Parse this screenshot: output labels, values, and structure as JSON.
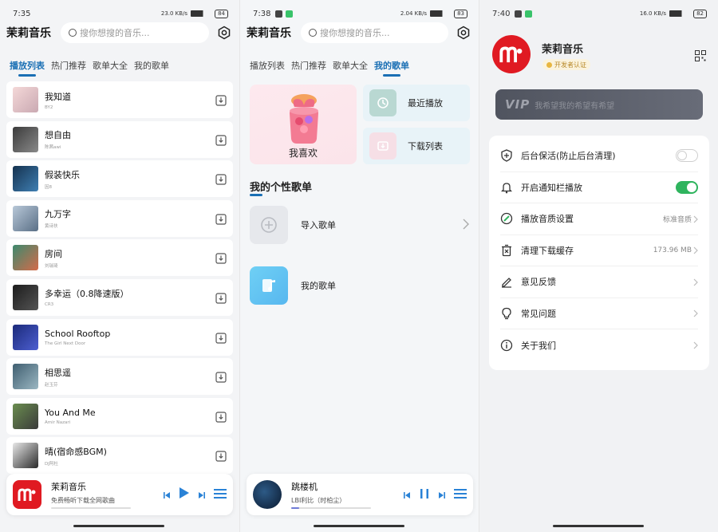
{
  "colors": {
    "accent": "#1a6fb4",
    "brand_red": "#e01a22",
    "toggle_on": "#2fb45e"
  },
  "panel1": {
    "status": {
      "time": "7:35",
      "speed": "23.0 KB/s",
      "battery": "84"
    },
    "app_title": "茉莉音乐",
    "search_placeholder": "搜你想搜的音乐...",
    "tabs": [
      "播放列表",
      "热门推荐",
      "歌单大全",
      "我的歌单"
    ],
    "active_tab": 0,
    "songs": [
      {
        "title": "我知道",
        "artist": "BY2"
      },
      {
        "title": "想自由",
        "artist": "陈茜awi"
      },
      {
        "title": "假装快乐",
        "artist": "因8"
      },
      {
        "title": "九万字",
        "artist": "黄诗扶"
      },
      {
        "title": "房间",
        "artist": "刘瑞琦"
      },
      {
        "title": "多幸运（0.8降速版）",
        "artist": "CR3"
      },
      {
        "title": "School Rooftop",
        "artist": "The Girl Next Door"
      },
      {
        "title": "相思遥",
        "artist": "赵玉芬"
      },
      {
        "title": "You And Me",
        "artist": "Amir Nazari"
      },
      {
        "title": "晴(宿命感BGM)",
        "artist": "DJ阿杜"
      }
    ],
    "player": {
      "title": "茉莉音乐",
      "subtitle": "免费畅听下载全网歌曲",
      "progress": 0
    }
  },
  "panel2": {
    "status": {
      "time": "7:38",
      "speed": "2.04 KB/s",
      "battery": "83"
    },
    "app_title": "茉莉音乐",
    "search_placeholder": "搜你想搜的音乐...",
    "tabs": [
      "播放列表",
      "热门推荐",
      "歌单大全",
      "我的歌单"
    ],
    "active_tab": 3,
    "favorite_label": "我喜欢",
    "recent_label": "最近播放",
    "download_label": "下载列表",
    "section_title": "我的个性歌单",
    "import_label": "导入歌单",
    "my_playlist_label": "我的歌单",
    "player": {
      "title": "跳楼机",
      "subtitle": "LBI利比（时柏尘）",
      "progress": 0.1
    }
  },
  "panel3": {
    "status": {
      "time": "7:40",
      "speed": "16.0 KB/s",
      "battery": "82"
    },
    "username": "茉莉音乐",
    "badge": "开发者认证",
    "vip_label": "VIP",
    "vip_text": "我希望我的希望有希望",
    "settings": [
      {
        "label": "后台保活(防止后台清理)",
        "type": "toggle",
        "on": false,
        "icon": "shield-icon"
      },
      {
        "label": "开启通知栏播放",
        "type": "toggle",
        "on": true,
        "icon": "bell-icon"
      },
      {
        "label": "播放音质设置",
        "type": "value",
        "value": "标准音质",
        "icon": "quality-icon"
      },
      {
        "label": "清理下载缓存",
        "type": "value",
        "value": "173.96 MB",
        "icon": "trash-icon"
      },
      {
        "label": "意见反馈",
        "type": "link",
        "icon": "pencil-icon"
      },
      {
        "label": "常见问题",
        "type": "link",
        "icon": "bulb-icon"
      },
      {
        "label": "关于我们",
        "type": "link",
        "icon": "info-icon"
      }
    ]
  }
}
